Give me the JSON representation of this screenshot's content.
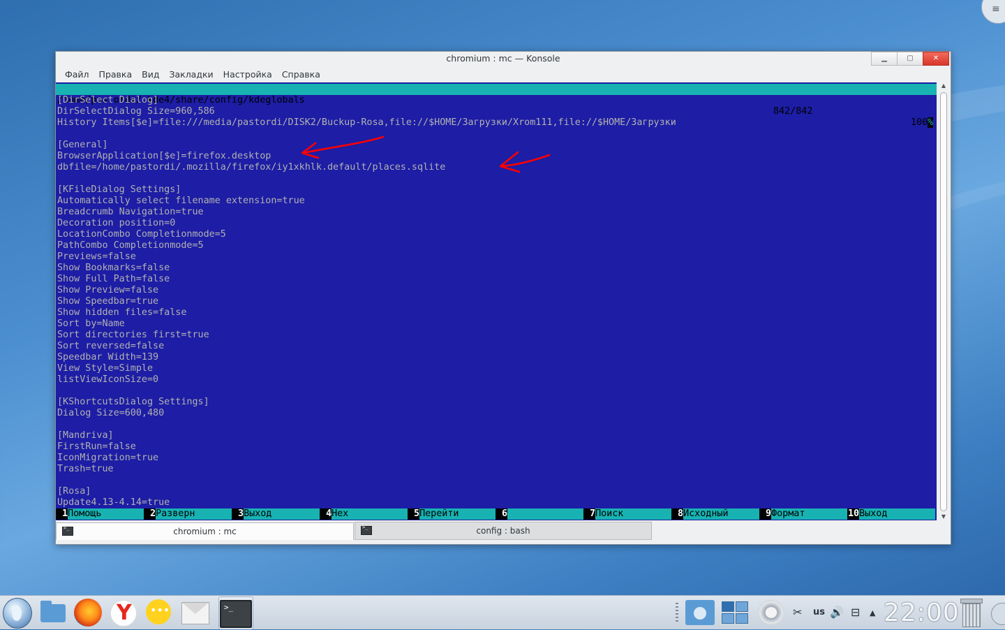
{
  "window": {
    "title": "chromium : mc — Konsole",
    "controls": {
      "minimize": "▁",
      "maximize": "▢",
      "close": "✕"
    }
  },
  "menu": [
    "Файл",
    "Правка",
    "Вид",
    "Закладки",
    "Настройка",
    "Справка"
  ],
  "status": {
    "path": "/home/pastordi/.kde4/share/config/kdeglobals",
    "count": "842/842",
    "percent": "100",
    "percent_sign": "%"
  },
  "lines": [
    "[DirSelect Dialog]",
    "DirSelectDialog Size=960,586",
    "History Items[$e]=file:///media/pastordi/DISK2/Buckup-Rosa,file://$HOME/Загрузки/Xrom111,file://$HOME/Загрузки",
    "",
    "[General]",
    "BrowserApplication[$e]=firefox.desktop",
    "dbfile=/home/pastordi/.mozilla/firefox/iy1xkhlk.default/places.sqlite",
    "",
    "[KFileDialog Settings]",
    "Automatically select filename extension=true",
    "Breadcrumb Navigation=true",
    "Decoration position=0",
    "LocationCombo Completionmode=5",
    "PathCombo Completionmode=5",
    "Previews=false",
    "Show Bookmarks=false",
    "Show Full Path=false",
    "Show Preview=false",
    "Show Speedbar=true",
    "Show hidden files=false",
    "Sort by=Name",
    "Sort directories first=true",
    "Sort reversed=false",
    "Speedbar Width=139",
    "View Style=Simple",
    "listViewIconSize=0",
    "",
    "[KShortcutsDialog Settings]",
    "Dialog Size=600,480",
    "",
    "[Mandriva]",
    "FirstRun=false",
    "IconMigration=true",
    "Trash=true",
    "",
    "[Rosa]",
    "Update4.13-4.14=true"
  ],
  "fkeys": [
    {
      "num": "1",
      "label": "Помощь"
    },
    {
      "num": "2",
      "label": "Разверн"
    },
    {
      "num": "3",
      "label": "Выход"
    },
    {
      "num": "4",
      "label": "Hex"
    },
    {
      "num": "5",
      "label": "Перейти"
    },
    {
      "num": "6",
      "label": ""
    },
    {
      "num": "7",
      "label": "Поиск"
    },
    {
      "num": "8",
      "label": "Исходный"
    },
    {
      "num": "9",
      "label": "Формат"
    },
    {
      "num": "10",
      "label": "Выход"
    }
  ],
  "tabs": [
    {
      "label": "chromium : mc",
      "active": true
    },
    {
      "label": "config : bash",
      "active": false
    }
  ],
  "colors": {
    "terminal_bg": "#1d1da5",
    "terminal_fg": "#b2b2b2",
    "mc_cyan": "#18b2b2",
    "annotation_red": "#ff0000"
  },
  "taskbar": {
    "icons": [
      "launcher-icon",
      "file-manager-icon",
      "firefox-icon",
      "yandex-browser-icon",
      "chat-icon",
      "mail-icon",
      "konsole-icon"
    ],
    "tray": {
      "keyboard_layout": "us",
      "clock": "22:00"
    }
  }
}
